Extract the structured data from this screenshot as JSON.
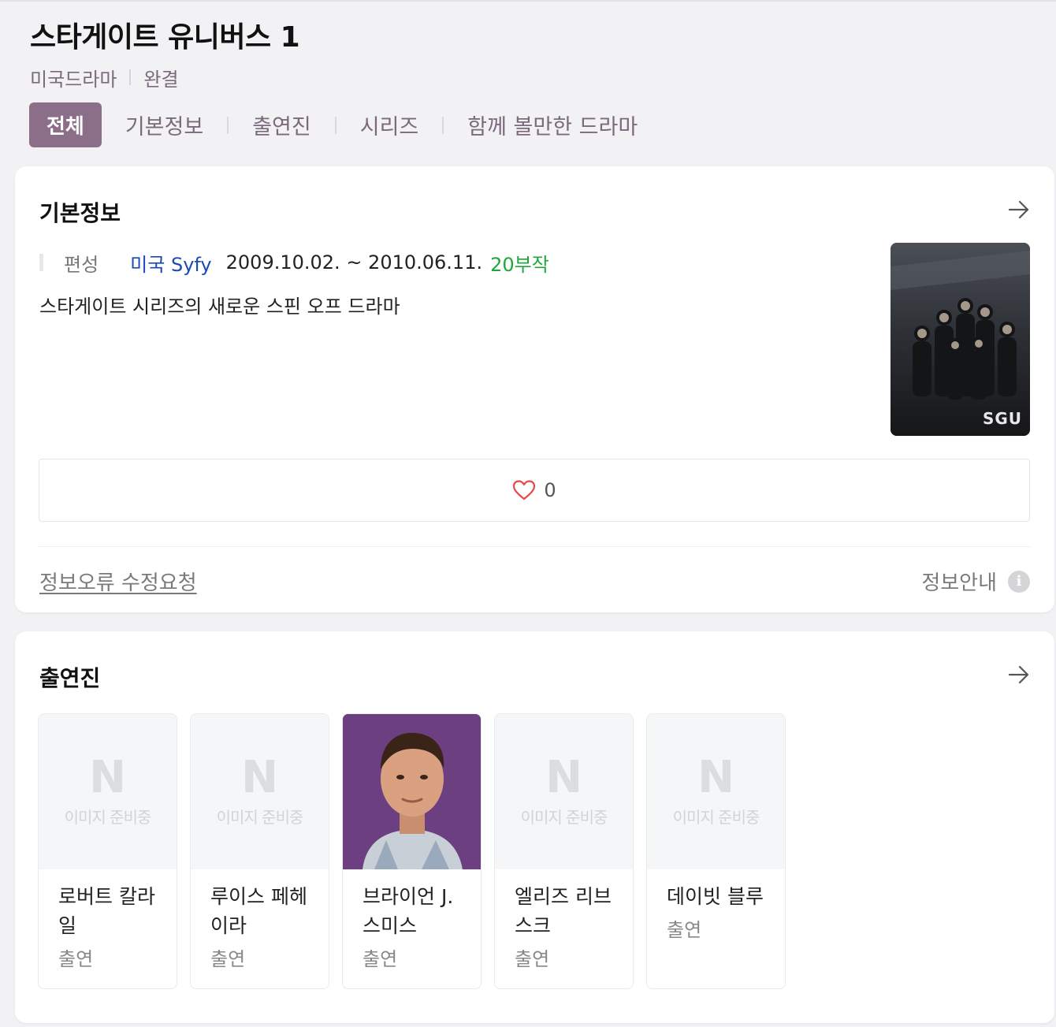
{
  "title": "스타게이트 유니버스 1",
  "genre": "미국드라마",
  "status": "완결",
  "tabs": [
    {
      "label": "전체",
      "active": true
    },
    {
      "label": "기본정보"
    },
    {
      "label": "출연진"
    },
    {
      "label": "시리즈"
    },
    {
      "label": "함께 볼만한 드라마"
    }
  ],
  "basic_info": {
    "heading": "기본정보",
    "broadcast_label": "편성",
    "channel": "미국 Syfy",
    "dates": "2009.10.02. ~ 2010.06.11.",
    "episodes": "20부작",
    "description": "스타게이트 시리즈의 새로운 스핀 오프 드라마",
    "poster_logo_text": "SGU",
    "likes": "0",
    "report_link": "정보오류 수정요청",
    "info_guide": "정보안내"
  },
  "cast": {
    "heading": "출연진",
    "placeholder_logo": "N",
    "placeholder_text": "이미지 준비중",
    "members": [
      {
        "name": "로버트 칼라일",
        "role": "출연",
        "has_photo": false
      },
      {
        "name": "루이스 페헤이라",
        "role": "출연",
        "has_photo": false
      },
      {
        "name": "브라이언 J. 스미스",
        "role": "출연",
        "has_photo": true
      },
      {
        "name": "엘리즈 리브스크",
        "role": "출연",
        "has_photo": false
      },
      {
        "name": "데이빗 블루",
        "role": "출연",
        "has_photo": false
      }
    ]
  },
  "colors": {
    "accent": "#8b6f88",
    "channel": "#1a49b8",
    "episodes": "#1fa83a",
    "heart": "#e5484d"
  }
}
